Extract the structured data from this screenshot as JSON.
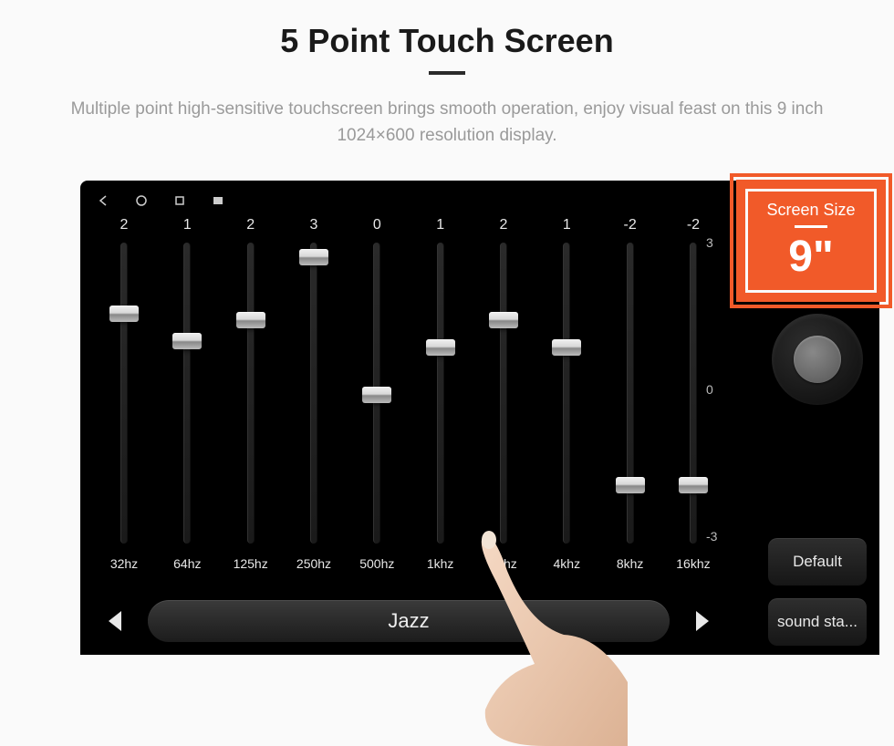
{
  "header": {
    "title": "5 Point Touch Screen",
    "subtitle": "Multiple point high-sensitive touchscreen brings smooth operation, enjoy visual feast on this 9 inch 1024×600 resolution display."
  },
  "callout": {
    "label": "Screen Size",
    "value": "9\""
  },
  "equalizer": {
    "preset": "Jazz",
    "scale": {
      "max": "3",
      "mid": "0",
      "min": "-3"
    },
    "bands": [
      {
        "value": "2",
        "freq": "32hz",
        "pos": 21
      },
      {
        "value": "1",
        "freq": "64hz",
        "pos": 30
      },
      {
        "value": "2",
        "freq": "125hz",
        "pos": 23
      },
      {
        "value": "3",
        "freq": "250hz",
        "pos": 2
      },
      {
        "value": "0",
        "freq": "500hz",
        "pos": 48
      },
      {
        "value": "1",
        "freq": "1khz",
        "pos": 32
      },
      {
        "value": "2",
        "freq": "2khz",
        "pos": 23
      },
      {
        "value": "1",
        "freq": "4khz",
        "pos": 32
      },
      {
        "value": "-2",
        "freq": "8khz",
        "pos": 78
      },
      {
        "value": "-2",
        "freq": "16khz",
        "pos": 78
      }
    ]
  },
  "side": {
    "default_btn": "Default",
    "sound_btn": "sound sta..."
  }
}
